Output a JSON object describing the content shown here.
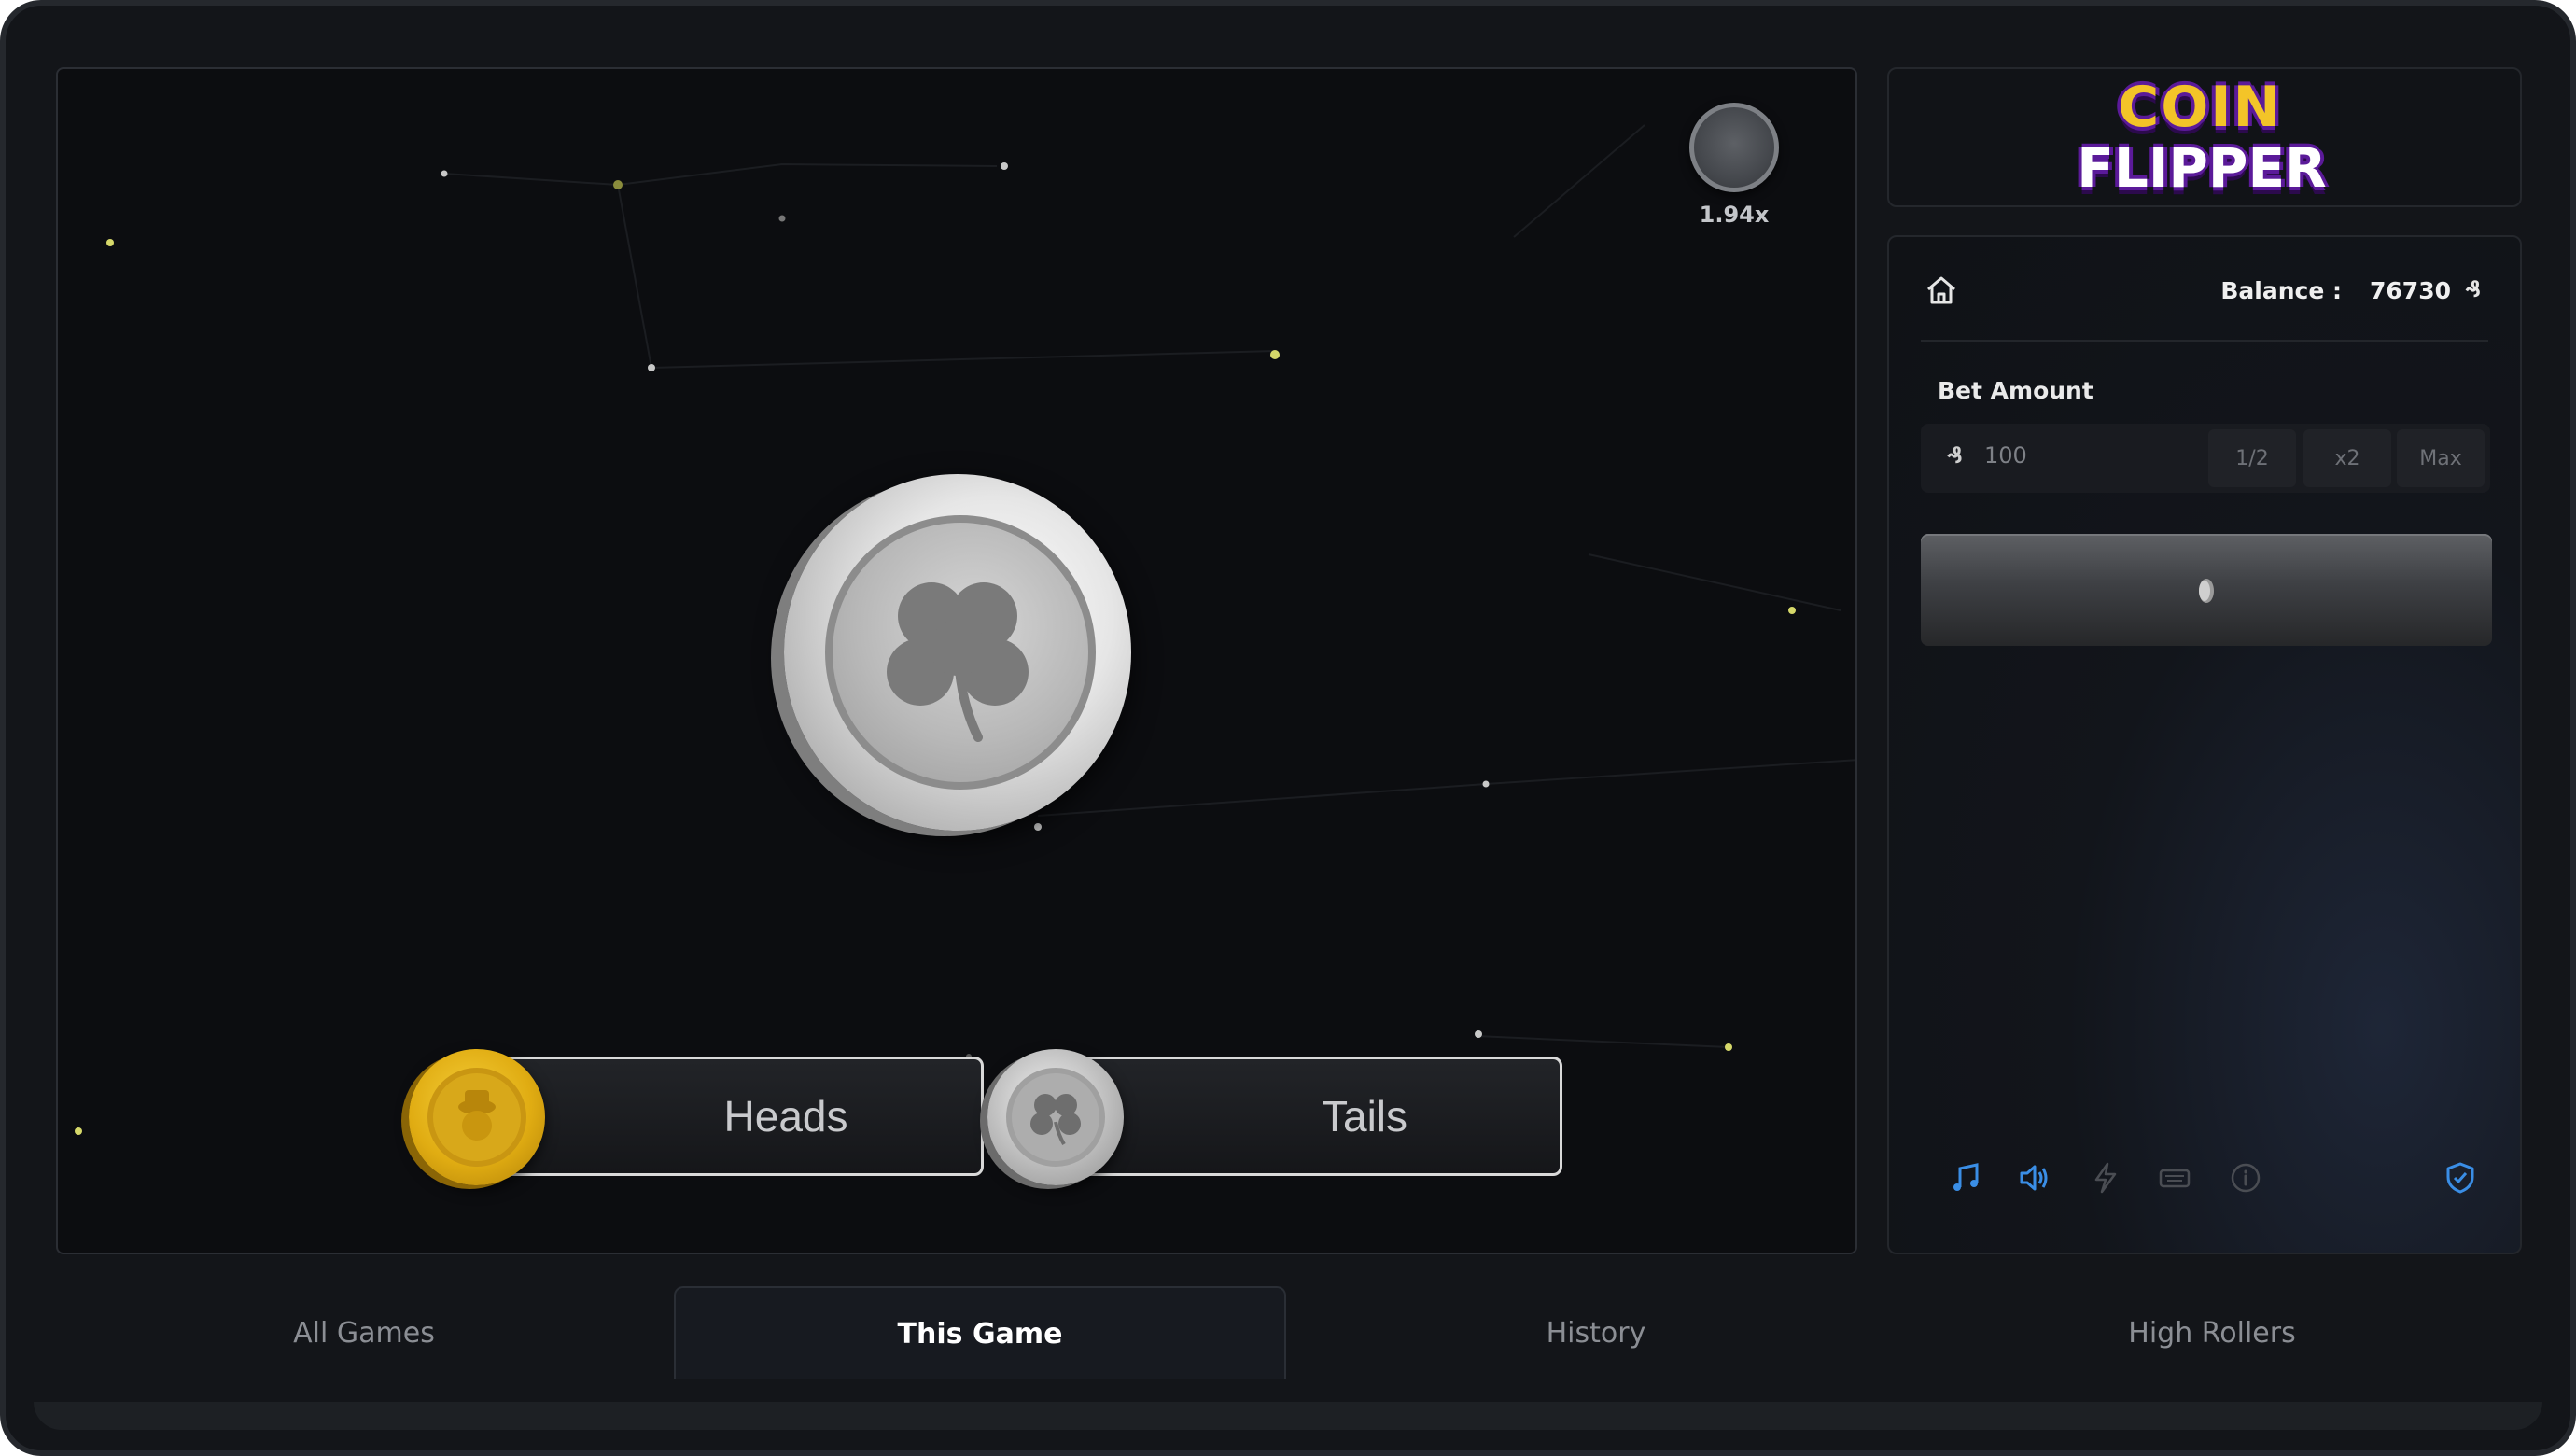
{
  "game": {
    "multiplier": "1.94x",
    "choices": [
      {
        "label": "Heads",
        "coin": "gold-leprechaun-coin"
      },
      {
        "label": "Tails",
        "coin": "silver-clover-coin"
      }
    ],
    "main_coin": "silver-clover-coin"
  },
  "logo": {
    "line1": "COIN",
    "line2": "FLIPPER"
  },
  "panel": {
    "balance_label": "Balance :",
    "balance_value": "76730",
    "currency_symbol": "₰",
    "bet_label": "Bet Amount",
    "bet_value": "100",
    "half_label": "1/2",
    "double_label": "x2",
    "max_label": "Max",
    "bottom_icons": [
      "music-icon",
      "volume-icon",
      "lightning-icon",
      "keyboard-icon",
      "info-icon",
      "shield-check-icon"
    ]
  },
  "tabs": [
    {
      "label": "All Games",
      "active": false
    },
    {
      "label": "This Game",
      "active": true
    },
    {
      "label": "History",
      "active": false
    },
    {
      "label": "High Rollers",
      "active": false
    }
  ],
  "colors": {
    "accent_blue": "#3a8ee6",
    "gold": "#e0ac12",
    "background": "#0c0d10"
  }
}
